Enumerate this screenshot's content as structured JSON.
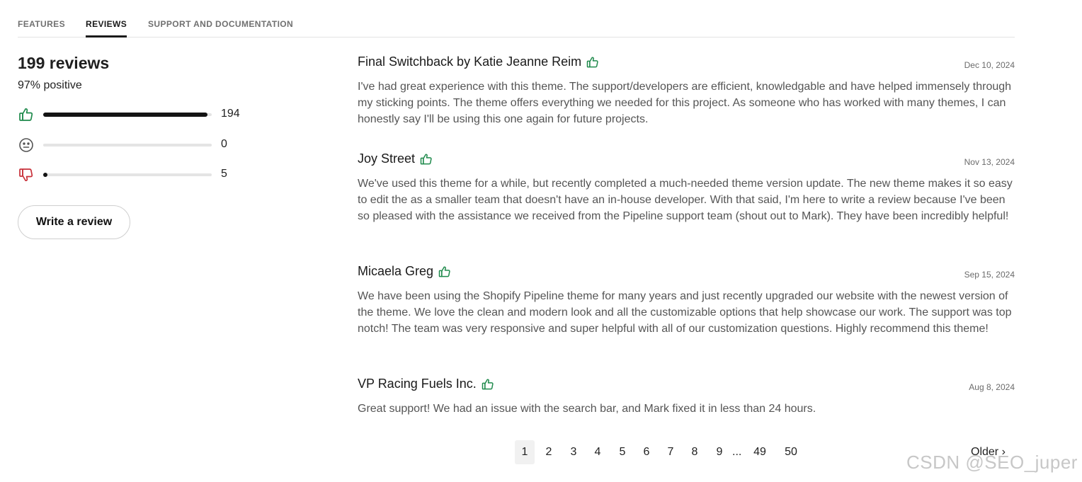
{
  "tabs": [
    {
      "label": "FEATURES"
    },
    {
      "label": "REVIEWS"
    },
    {
      "label": "SUPPORT AND DOCUMENTATION"
    }
  ],
  "summary": {
    "count_label": "199 reviews",
    "positive_label": "97% positive",
    "ratings": [
      {
        "icon": "thumbs-up-icon",
        "count": "194",
        "fraction": 0.975
      },
      {
        "icon": "neutral-face-icon",
        "count": "0",
        "fraction": 0
      },
      {
        "icon": "thumbs-down-icon",
        "count": "5",
        "fraction": 0.025
      }
    ],
    "write_button": "Write a review"
  },
  "colors": {
    "positive": "#1f8a4c",
    "negative": "#c8313a",
    "neutral": "#555555"
  },
  "reviews": [
    {
      "name": "Final Switchback by Katie Jeanne Reim",
      "date": "Dec 10, 2024",
      "sentiment_icon": "thumbs-up-icon",
      "body": "I've had great experience with this theme. The support/developers are efficient, knowledgable and have helped immensely through my sticking points. The theme offers everything we needed for this project. As someone who has worked with many themes, I can honestly say I'll be using this one again for future projects."
    },
    {
      "name": "Joy Street",
      "date": "Nov 13, 2024",
      "sentiment_icon": "thumbs-up-icon",
      "body": "We've used this theme for a while, but recently completed a much-needed theme version update. The new theme makes it so easy to edit the as a smaller team that doesn't have an in-house developer. With that said, I'm here to write a review because I've been so pleased with the assistance we received from the Pipeline support team (shout out to Mark). They have been incredibly helpful!"
    },
    {
      "name": "Micaela Greg",
      "date": "Sep 15, 2024",
      "sentiment_icon": "thumbs-up-icon",
      "body": "We have been using the Shopify Pipeline theme for many years and just recently upgraded our website with the newest version of the theme. We love the clean and modern look and all the customizable options that help showcase our work. The support was top notch! The team was very responsive and super helpful with all of our customization questions. Highly recommend this theme!"
    },
    {
      "name": "VP Racing Fuels Inc.",
      "date": "Aug 8, 2024",
      "sentiment_icon": "thumbs-up-icon",
      "body": "Great support! We had an issue with the search bar, and Mark fixed it in less than 24 hours."
    }
  ],
  "pagination": {
    "pages": [
      "1",
      "2",
      "3",
      "4",
      "5",
      "6",
      "7",
      "8",
      "9"
    ],
    "ellipsis": "...",
    "last_pages": [
      "49",
      "50"
    ],
    "current": "1",
    "older_label": "Older ›"
  },
  "watermark": "CSDN @SEO_juper"
}
